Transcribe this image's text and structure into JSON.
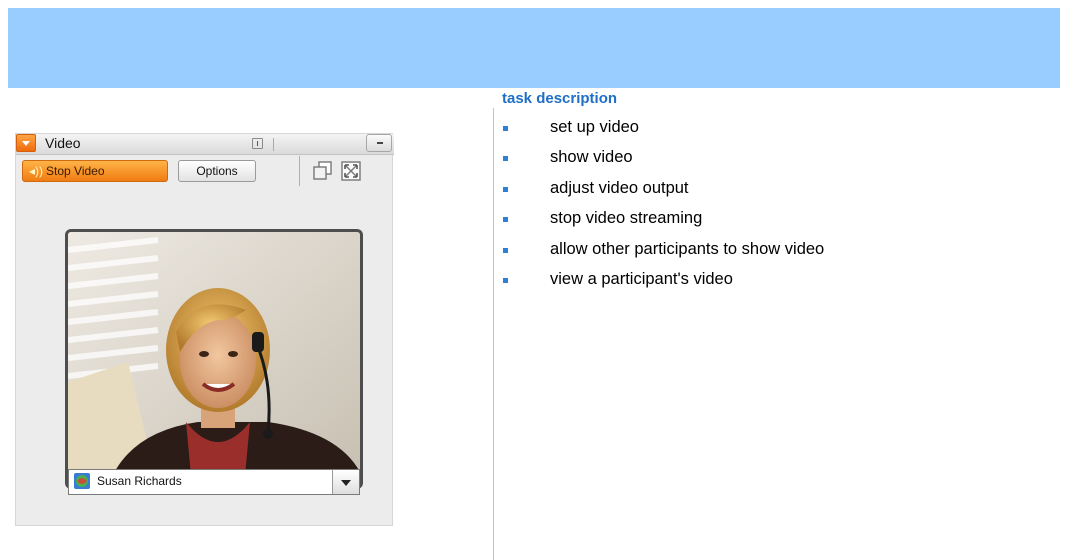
{
  "task_panel": {
    "title": "task description",
    "items": [
      "set up video",
      "show video",
      "adjust video output",
      "stop video streaming",
      "allow other participants to show video",
      "view a participant's video"
    ]
  },
  "pod": {
    "title": "Video",
    "stop_button": "Stop Video",
    "options_button": "Options",
    "participant_name": "Susan Richards",
    "icons": [
      "pod-menu-icon",
      "grip-icon",
      "minimize-icon",
      "play-icon",
      "popout-icon",
      "fullscreen-icon",
      "participant-icon",
      "dropdown-icon"
    ]
  },
  "colors": {
    "banner": "#99ccff",
    "accent_orange": "#f07c12",
    "task_title": "#1f6fc5",
    "bullet": "#2e80d6"
  }
}
